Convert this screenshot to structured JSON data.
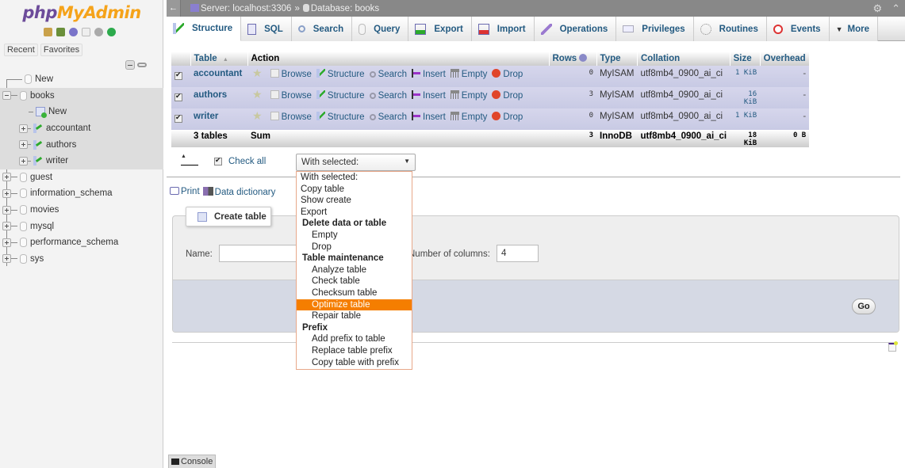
{
  "sidebar": {
    "logo": {
      "php": "php",
      "my": "My",
      "admin": "Admin"
    },
    "quick_icons": [
      "home-icon",
      "logout-icon",
      "help-icon",
      "docs-icon",
      "settings-icon",
      "reload-icon"
    ],
    "tabs": [
      "Recent",
      "Favorites"
    ],
    "tree": [
      {
        "label": "New",
        "type": "new",
        "level": 0
      },
      {
        "label": "books",
        "type": "db",
        "level": 0,
        "expanded": true,
        "selected": true
      },
      {
        "label": "New",
        "type": "new",
        "level": 1
      },
      {
        "label": "accountant",
        "type": "table",
        "level": 1
      },
      {
        "label": "authors",
        "type": "table",
        "level": 1
      },
      {
        "label": "writer",
        "type": "table",
        "level": 1
      },
      {
        "label": "guest",
        "type": "db",
        "level": 0
      },
      {
        "label": "information_schema",
        "type": "db",
        "level": 0
      },
      {
        "label": "movies",
        "type": "db",
        "level": 0
      },
      {
        "label": "mysql",
        "type": "db",
        "level": 0
      },
      {
        "label": "performance_schema",
        "type": "db",
        "level": 0
      },
      {
        "label": "sys",
        "type": "db",
        "level": 0
      }
    ]
  },
  "breadcrumb": {
    "back": "←",
    "server": "Server: localhost:3306",
    "sep": "»",
    "database": "Database: books"
  },
  "tabs": [
    {
      "label": "Structure",
      "icon": "structure-icon",
      "active": true
    },
    {
      "label": "SQL",
      "icon": "sql-icon"
    },
    {
      "label": "Search",
      "icon": "search-icon"
    },
    {
      "label": "Query",
      "icon": "query-icon"
    },
    {
      "label": "Export",
      "icon": "export-icon"
    },
    {
      "label": "Import",
      "icon": "import-icon"
    },
    {
      "label": "Operations",
      "icon": "operations-icon"
    },
    {
      "label": "Privileges",
      "icon": "privileges-icon"
    },
    {
      "label": "Routines",
      "icon": "routines-icon"
    },
    {
      "label": "Events",
      "icon": "events-icon"
    },
    {
      "label": "More",
      "icon": "caret-down-icon"
    }
  ],
  "table": {
    "headers": {
      "table": "Table",
      "sort": "▲",
      "action": "Action",
      "rows": "Rows",
      "type": "Type",
      "collation": "Collation",
      "size": "Size",
      "overhead": "Overhead"
    },
    "actions": [
      "Browse",
      "Structure",
      "Search",
      "Insert",
      "Empty",
      "Drop"
    ],
    "rows": [
      {
        "name": "accountant",
        "rows": "0",
        "type": "MyISAM",
        "collation": "utf8mb4_0900_ai_ci",
        "size": "1 KiB",
        "overhead": "-",
        "checked": true
      },
      {
        "name": "authors",
        "rows": "3",
        "type": "MyISAM",
        "collation": "utf8mb4_0900_ai_ci",
        "size": "16 KiB",
        "overhead": "-",
        "checked": true
      },
      {
        "name": "writer",
        "rows": "0",
        "type": "MyISAM",
        "collation": "utf8mb4_0900_ai_ci",
        "size": "1 KiB",
        "overhead": "-",
        "checked": true
      }
    ],
    "summary": {
      "count": "3 tables",
      "label": "Sum",
      "rows": "3",
      "type": "InnoDB",
      "collation": "utf8mb4_0900_ai_ci",
      "size": "18 KiB",
      "overhead": "0 B"
    }
  },
  "bulk": {
    "check_all": "Check all",
    "with_selected": "With selected:"
  },
  "dropdown": [
    {
      "label": "With selected:",
      "kind": "item"
    },
    {
      "label": "Copy table",
      "kind": "item"
    },
    {
      "label": "Show create",
      "kind": "item"
    },
    {
      "label": "Export",
      "kind": "item"
    },
    {
      "label": "Delete data or table",
      "kind": "grp"
    },
    {
      "label": "Empty",
      "kind": "sub"
    },
    {
      "label": "Drop",
      "kind": "sub"
    },
    {
      "label": "Table maintenance",
      "kind": "grp"
    },
    {
      "label": "Analyze table",
      "kind": "sub"
    },
    {
      "label": "Check table",
      "kind": "sub"
    },
    {
      "label": "Checksum table",
      "kind": "sub"
    },
    {
      "label": "Optimize table",
      "kind": "sub",
      "highlighted": true
    },
    {
      "label": "Repair table",
      "kind": "sub"
    },
    {
      "label": "Prefix",
      "kind": "grp"
    },
    {
      "label": "Add prefix to table",
      "kind": "sub"
    },
    {
      "label": "Replace table prefix",
      "kind": "sub"
    },
    {
      "label": "Copy table with prefix",
      "kind": "sub"
    }
  ],
  "links": {
    "print": "Print",
    "data_dictionary": "Data dictionary"
  },
  "create_table": {
    "legend": "Create table",
    "name_label": "Name:",
    "name_value": "",
    "columns_label": "Number of columns:",
    "columns_value": "4",
    "go": "Go"
  },
  "console": {
    "label": "Console"
  },
  "colors": {
    "highlight": "#f57e00",
    "link": "#235a81"
  }
}
